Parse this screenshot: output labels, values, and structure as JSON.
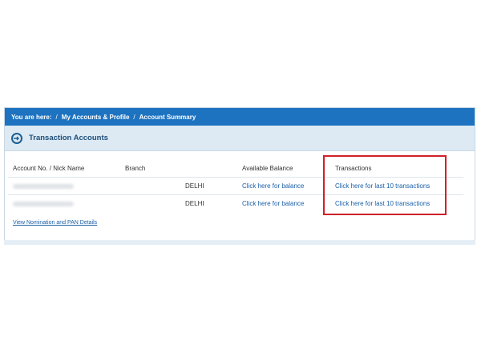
{
  "breadcrumb": {
    "prefix": "You are here:",
    "separator": "/",
    "items": [
      "My Accounts & Profile",
      "Account Summary"
    ]
  },
  "section": {
    "title": "Transaction Accounts"
  },
  "table": {
    "columns": [
      "Account No. / Nick Name",
      "Branch",
      "Available Balance",
      "Transactions"
    ],
    "rows": [
      {
        "account": "",
        "branch": "DELHI",
        "balance_link": "Click here for balance",
        "transactions_link": "Click here for last 10 transactions"
      },
      {
        "account": "",
        "branch": "DELHI",
        "balance_link": "Click here for balance",
        "transactions_link": "Click here for last 10 transactions"
      }
    ]
  },
  "footer": {
    "link": "View Nomination and PAN Details"
  },
  "colors": {
    "header_bar": "#1d73c0",
    "section_bg": "#ddeaf3",
    "link": "#1a5fa6",
    "highlight": "#d0202a"
  },
  "icons": {
    "section": "circle-arrow-icon"
  }
}
